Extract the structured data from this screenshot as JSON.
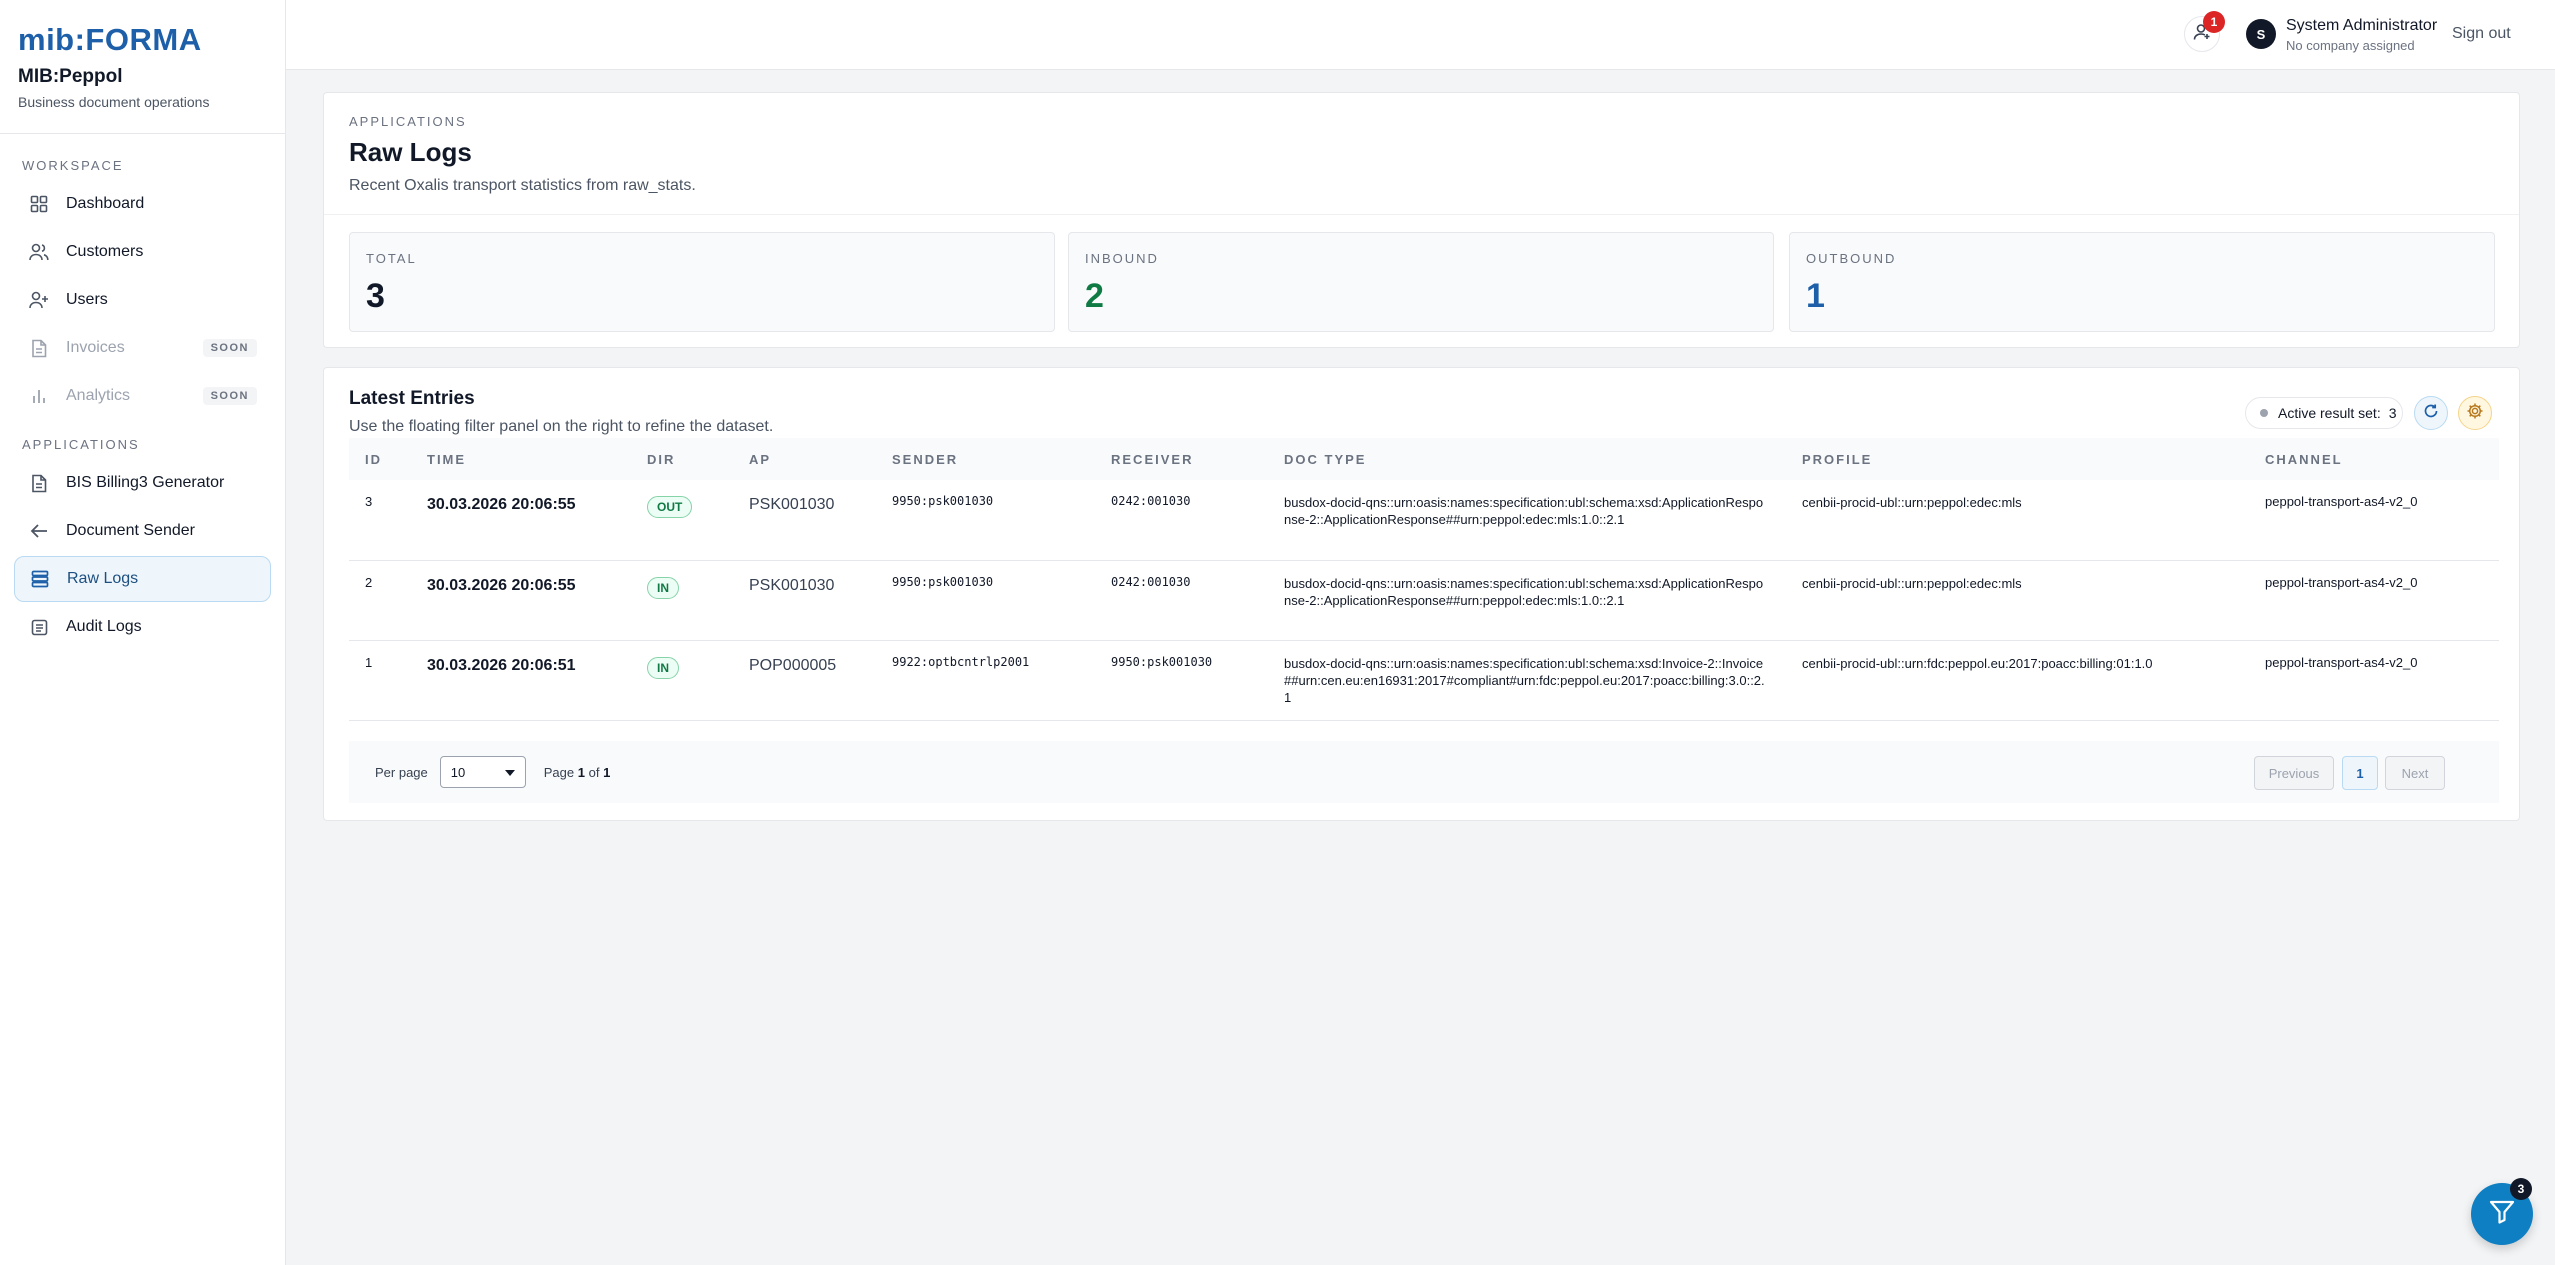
{
  "brand": {
    "logo": "mib:FORMA",
    "app_name": "MIB:Peppol",
    "app_sub": "Business document operations"
  },
  "sidebar": {
    "workspace_label": "WORKSPACE",
    "applications_label": "APPLICATIONS",
    "workspace_items": [
      {
        "label": "Dashboard",
        "icon": "grid-icon"
      },
      {
        "label": "Customers",
        "icon": "users-icon"
      },
      {
        "label": "Users",
        "icon": "user-plus-icon"
      },
      {
        "label": "Invoices",
        "icon": "file-icon",
        "badge": "SOON"
      },
      {
        "label": "Analytics",
        "icon": "bar-chart-icon",
        "badge": "SOON"
      }
    ],
    "application_items": [
      {
        "label": "BIS Billing3 Generator",
        "icon": "file-icon"
      },
      {
        "label": "Document Sender",
        "icon": "arrow-left-icon"
      },
      {
        "label": "Raw Logs",
        "icon": "database-icon",
        "active": true
      },
      {
        "label": "Audit Logs",
        "icon": "list-icon"
      }
    ]
  },
  "header": {
    "notification_count": "1",
    "avatar_initial": "S",
    "user_name": "System Administrator",
    "user_company": "No company assigned",
    "sign_out": "Sign out"
  },
  "page": {
    "eyebrow": "APPLICATIONS",
    "title": "Raw Logs",
    "subtitle": "Recent Oxalis transport statistics from raw_stats."
  },
  "stats": [
    {
      "label": "TOTAL",
      "value": "3",
      "color": "#111827"
    },
    {
      "label": "INBOUND",
      "value": "2",
      "color": "#0f7a43"
    },
    {
      "label": "OUTBOUND",
      "value": "1",
      "color": "#1d5fa8"
    }
  ],
  "entries": {
    "title": "Latest Entries",
    "subtitle": "Use the floating filter panel on the right to refine the dataset.",
    "result_label": "Active result set:",
    "result_count": "3",
    "columns": [
      "ID",
      "TIME",
      "DIR",
      "AP",
      "SENDER",
      "RECEIVER",
      "DOC TYPE",
      "PROFILE",
      "CHANNEL"
    ],
    "rows": [
      {
        "id": "3",
        "time": "30.03.2026 20:06:55",
        "dir": "OUT",
        "ap": "PSK001030",
        "sender": "9950:psk001030",
        "receiver": "0242:001030",
        "doc_type": "busdox-docid-qns::urn:oasis:names:specification:ubl:schema:xsd:ApplicationResponse-2::ApplicationResponse##urn:peppol:edec:mls:1.0::2.1",
        "profile": "cenbii-procid-ubl::urn:peppol:edec:mls",
        "channel": "peppol-transport-as4-v2_0"
      },
      {
        "id": "2",
        "time": "30.03.2026 20:06:55",
        "dir": "IN",
        "ap": "PSK001030",
        "sender": "9950:psk001030",
        "receiver": "0242:001030",
        "doc_type": "busdox-docid-qns::urn:oasis:names:specification:ubl:schema:xsd:ApplicationResponse-2::ApplicationResponse##urn:peppol:edec:mls:1.0::2.1",
        "profile": "cenbii-procid-ubl::urn:peppol:edec:mls",
        "channel": "peppol-transport-as4-v2_0"
      },
      {
        "id": "1",
        "time": "30.03.2026 20:06:51",
        "dir": "IN",
        "ap": "POP000005",
        "sender": "9922:optbcntrlp2001",
        "receiver": "9950:psk001030",
        "doc_type": "busdox-docid-qns::urn:oasis:names:specification:ubl:schema:xsd:Invoice-2::Invoice##urn:cen.eu:en16931:2017#compliant#urn:fdc:peppol.eu:2017:poacc:billing:3.0::2.1",
        "profile": "cenbii-procid-ubl::urn:fdc:peppol.eu:2017:poacc:billing:01:1.0",
        "channel": "peppol-transport-as4-v2_0"
      }
    ]
  },
  "pagination": {
    "per_page_label": "Per page",
    "per_page_value": "10",
    "page_word": "Page",
    "of_word": "of",
    "current_page": "1",
    "total_pages": "1",
    "previous": "Previous",
    "next": "Next"
  },
  "filter_fab": {
    "badge": "3"
  }
}
